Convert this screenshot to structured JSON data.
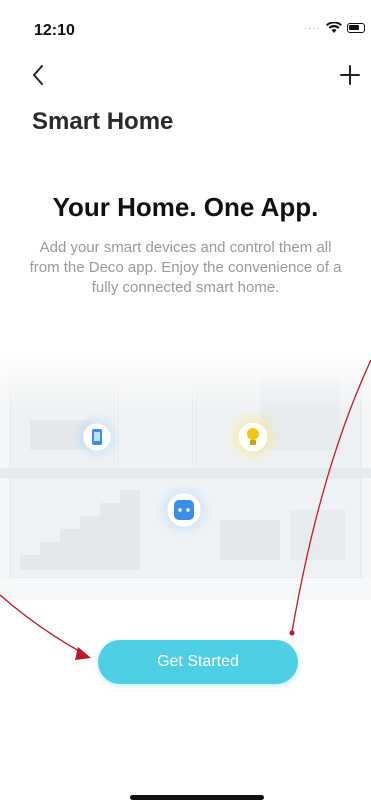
{
  "status_bar": {
    "time": "12:10"
  },
  "nav": {
    "back_icon": "chevron-left-icon",
    "add_icon": "plus-icon"
  },
  "page_title": "Smart Home",
  "hero": {
    "title": "Your Home. One App.",
    "description": "Add your smart devices and control them all from the Deco app. Enjoy the convenience of a fully connected smart home."
  },
  "illustration": {
    "device_icons": [
      "phone-icon",
      "bulb-icon",
      "smart-plug-icon"
    ]
  },
  "actions": {
    "get_started_label": "Get Started"
  },
  "colors": {
    "accent": "#4fcfe3",
    "bulb": "#f5c518",
    "device_blue": "#3a8fe8",
    "annotation": "#c0182b"
  }
}
